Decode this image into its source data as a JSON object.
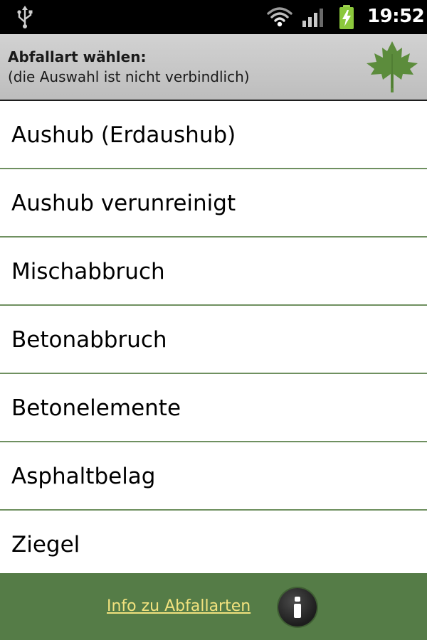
{
  "status_bar": {
    "time": "19:52",
    "icons": [
      "usb-icon",
      "wifi-icon",
      "signal-icon",
      "battery-charging-icon"
    ]
  },
  "header": {
    "title": "Abfallart wählen:",
    "subtitle": "(die Auswahl ist nicht verbindlich)",
    "logo_icon": "maple-leaf-icon"
  },
  "waste_types": {
    "items": [
      {
        "label": "Aushub (Erdaushub)"
      },
      {
        "label": "Aushub verunreinigt"
      },
      {
        "label": "Mischabbruch"
      },
      {
        "label": "Betonabbruch"
      },
      {
        "label": "Betonelemente"
      },
      {
        "label": "Asphaltbelag"
      },
      {
        "label": "Ziegel"
      }
    ]
  },
  "footer": {
    "info_link": "Info zu Abfallarten",
    "info_icon": "info-icon"
  },
  "colors": {
    "status_bar_bg": "#000000",
    "header_bg": "#c8c8c8",
    "divider": "#6f9060",
    "footer_bg": "#557c47",
    "link": "#f1e27e",
    "leaf": "#5c8c3c",
    "battery": "#8cc83c"
  }
}
